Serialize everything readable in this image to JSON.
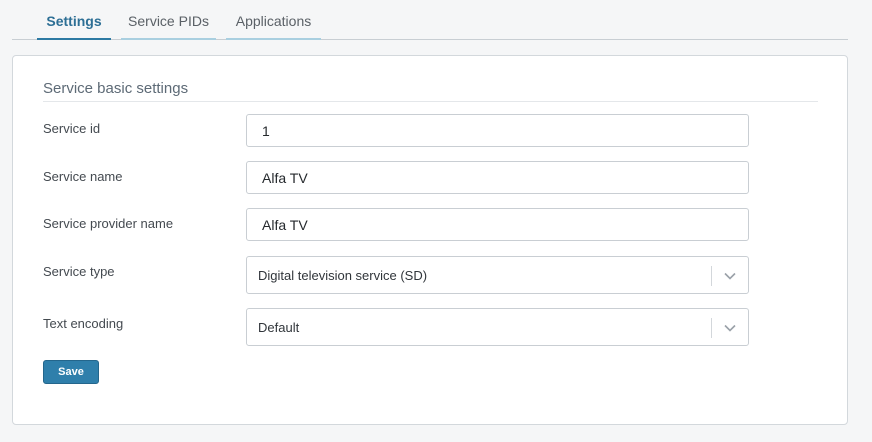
{
  "tabs": [
    {
      "label": "Settings",
      "active": true
    },
    {
      "label": "Service PIDs",
      "active": false
    },
    {
      "label": "Applications",
      "active": false
    }
  ],
  "section": {
    "title": "Service basic settings"
  },
  "form": {
    "service_id": {
      "label": "Service id",
      "value": "1"
    },
    "service_name": {
      "label": "Service name",
      "value": "Alfa TV"
    },
    "provider_name": {
      "label": "Service provider name",
      "value": "Alfa TV"
    },
    "service_type": {
      "label": "Service type",
      "value": "Digital television service (SD)"
    },
    "text_encoding": {
      "label": "Text encoding",
      "value": "Default"
    }
  },
  "actions": {
    "save_label": "Save"
  },
  "colors": {
    "accent": "#2f7fab",
    "tab_active": "#2d6f95",
    "tab_underline": "#a9cfe0"
  },
  "icons": {
    "select_toggle": "chevron-down-icon"
  }
}
